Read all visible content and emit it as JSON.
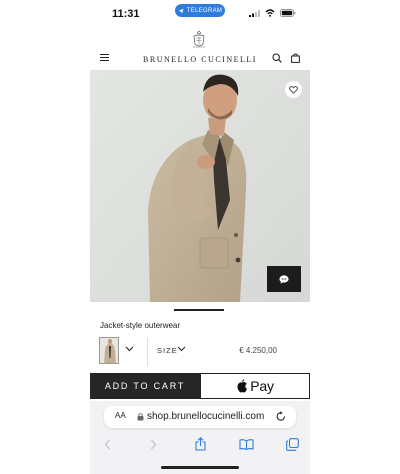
{
  "status_bar": {
    "time": "11:31",
    "pill_label": "TELEGRAM",
    "pill_color": "#2f7ddb"
  },
  "header": {
    "brand": "BRUNELLO CUCINELLI",
    "menu_icon": "hamburger-menu-icon",
    "search_icon": "search-icon",
    "bag_icon": "shopping-bag-icon"
  },
  "product": {
    "image_alt_icon": "product-photo",
    "title": "Jacket-style outerwear",
    "size_label": "SIZE",
    "price": "€ 4.250,00",
    "wishlist_icon": "heart-icon",
    "chat_icon": "chat-bubble-icon",
    "gallery": {
      "slides": 4,
      "active_index": 2
    }
  },
  "actions": {
    "add_to_cart": "ADD TO CART",
    "apple_pay": "Pay",
    "apple_pay_bg": "#ffffff",
    "cart_bg": "#262626"
  },
  "safari": {
    "aa_label": "AA",
    "url": "shop.brunellocucinelli.com",
    "accent": "#2f7ddb"
  }
}
